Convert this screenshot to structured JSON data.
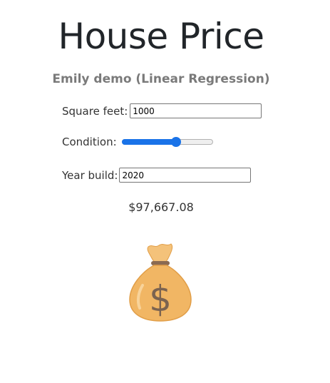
{
  "header": {
    "title": "House Price",
    "subtitle": "Emily demo (Linear Regression)"
  },
  "form": {
    "square_feet": {
      "label": "Square feet:",
      "value": "1000"
    },
    "condition": {
      "label": "Condition:",
      "value_fraction": 0.59
    },
    "year_build": {
      "label": "Year build:",
      "value": "2020"
    }
  },
  "result": {
    "price": "$97,667.08",
    "icon": "money-bag-icon"
  },
  "colors": {
    "accent": "#1a73e8",
    "bag": "#f1b664",
    "bag_shadow": "#e19e48",
    "dollar": "#7b6350"
  }
}
